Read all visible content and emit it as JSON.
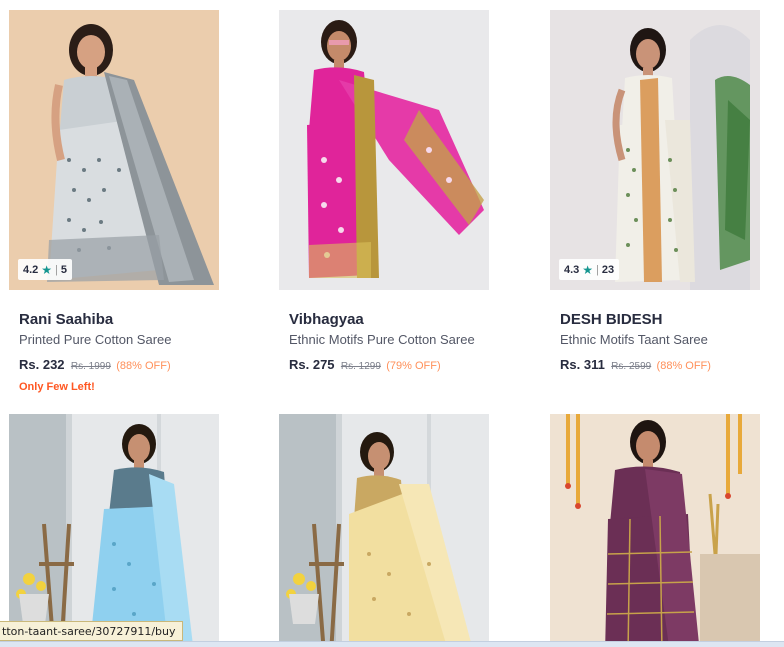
{
  "products": [
    {
      "brand": "Rani Saahiba",
      "title": "Printed Pure Cotton Saree",
      "price": "Rs. 232",
      "mrp": "Rs. 1999",
      "discount": "(88% OFF)",
      "rating": "4.2",
      "rating_count": "5",
      "badge": "Only Few Left!",
      "image": {
        "bg": "#e8c9a7",
        "saree": "#d9dde0",
        "border": "#8d9499",
        "skin": "#d6a182",
        "hair": "#2b1d17"
      }
    },
    {
      "brand": "Vibhagyaa",
      "title": "Ethnic Motifs Pure Cotton Saree",
      "price": "Rs. 275",
      "mrp": "Rs. 1299",
      "discount": "(79% OFF)",
      "image": {
        "bg": "#e9e9eb",
        "saree": "#e0249a",
        "border": "#b8963c",
        "skin": "#c48a6a",
        "hair": "#2a1b14"
      }
    },
    {
      "brand": "DESH BIDESH",
      "title": "Ethnic Motifs Taant Saree",
      "price": "Rs. 311",
      "mrp": "Rs. 2599",
      "discount": "(88% OFF)",
      "rating": "4.3",
      "rating_count": "23",
      "image": {
        "bg": "#e7e3e4",
        "saree": "#f1efe8",
        "border": "#d89550",
        "skin": "#c99378",
        "hair": "#1f1613"
      }
    },
    {
      "image": {
        "bg": "#b9c1c5",
        "saree": "#8fd0ef",
        "border": "#5a7b8c",
        "skin": "#c69072",
        "hair": "#24190f"
      }
    },
    {
      "image": {
        "bg": "#b9c1c5",
        "saree": "#f2dfa0",
        "border": "#c9a862",
        "skin": "#c69072",
        "hair": "#24190f"
      }
    },
    {
      "image": {
        "bg": "#efe2d2",
        "saree": "#6b2f55",
        "border": "#c7a24a",
        "skin": "#c58b6e",
        "hair": "#1e1410"
      }
    }
  ],
  "status_url": "tton-taant-saree/30727911/buy",
  "icons": {
    "rating_star": "star-icon"
  }
}
